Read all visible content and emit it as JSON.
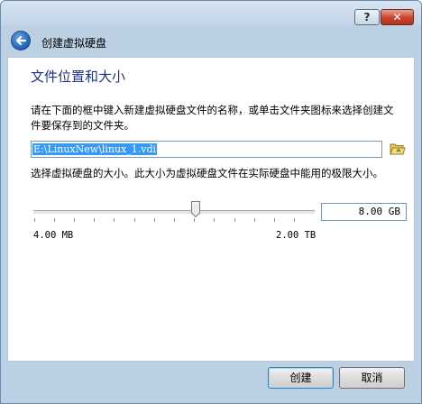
{
  "titlebar": {
    "help_label": "?",
    "close_label": "✕"
  },
  "header": {
    "title": "创建虚拟硬盘",
    "back_icon": "back-arrow-icon"
  },
  "section": {
    "title": "文件位置和大小",
    "description": "请在下面的框中键入新建虚拟硬盘文件的名称，或单击文件夹图标来选择创建文件要保存到的文件夹。"
  },
  "location": {
    "value": "E:\\LinuxNew\\linux_1.vdi",
    "folder_icon": "folder-open-icon"
  },
  "size": {
    "label": "选择虚拟硬盘的大小。此大小为虚拟硬盘文件在实际硬盘中能用的极限大小。",
    "value": "8.00 GB",
    "slider_position": 0.576,
    "min_label": "4.00 MB",
    "max_label": "2.00 TB"
  },
  "buttons": {
    "create": "创建",
    "cancel": "取消"
  },
  "colors": {
    "title_blue": "#1e3287",
    "selection": "#3399ff",
    "close_red": "#c6432c"
  }
}
